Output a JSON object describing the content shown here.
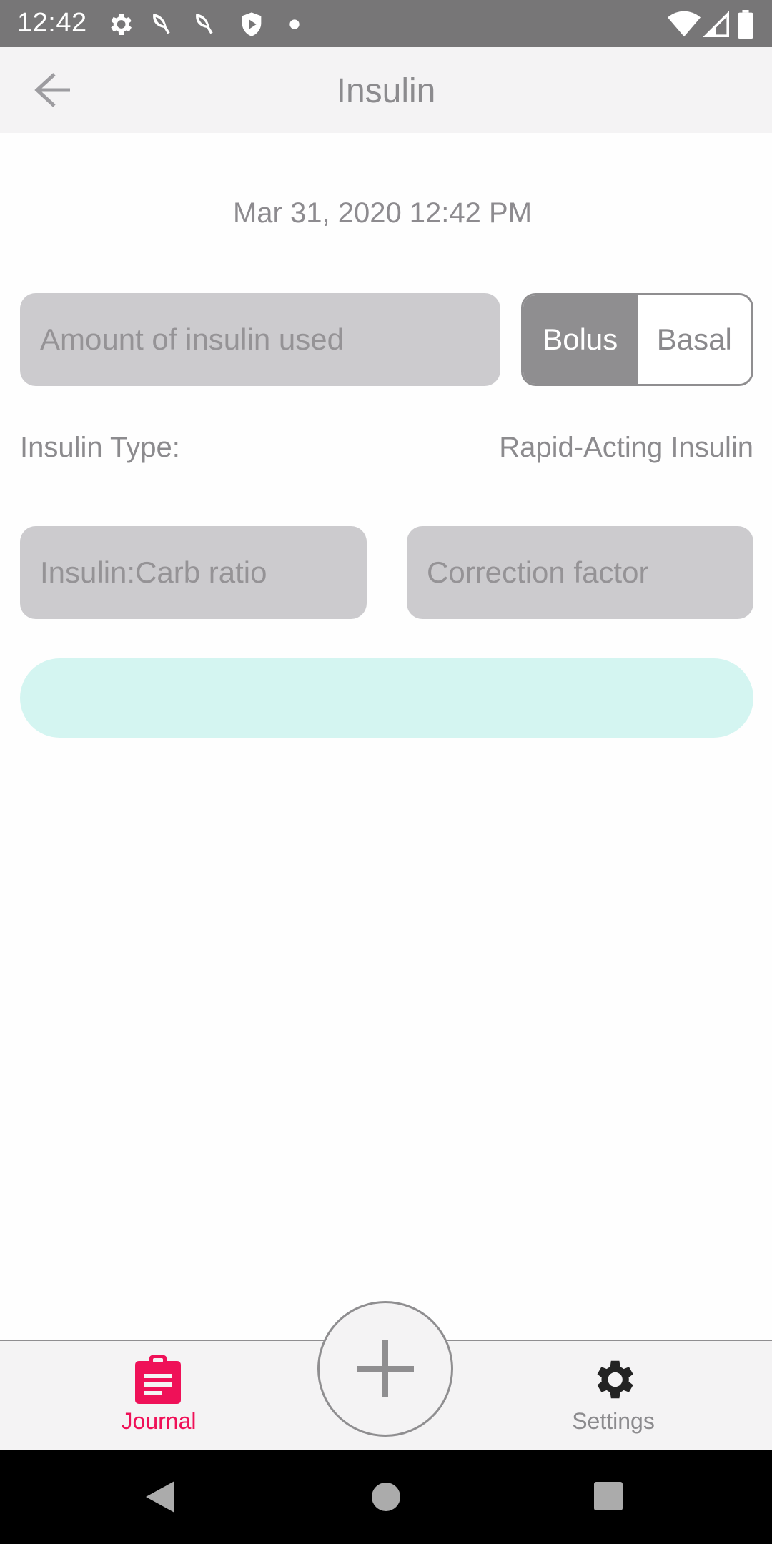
{
  "status_bar": {
    "time": "12:42",
    "left_icons": [
      "gear-icon",
      "leaf-icon",
      "leaf-icon",
      "shield-icon",
      "dot-icon"
    ],
    "right_icons": [
      "wifi-icon",
      "cell-signal-icon",
      "battery-icon"
    ]
  },
  "app_bar": {
    "title": "Insulin",
    "back_icon": "arrow-left-icon"
  },
  "form": {
    "datetime": "Mar 31, 2020 12:42 PM",
    "amount_placeholder": "Amount of insulin used",
    "toggle": {
      "options": [
        "Bolus",
        "Basal"
      ],
      "selected": "Bolus"
    },
    "insulin_type_label": "Insulin Type:",
    "insulin_type_value": "Rapid-Acting Insulin",
    "carb_ratio_placeholder": "Insulin:Carb ratio",
    "correction_factor_placeholder": "Correction factor",
    "save_button_color": "#d4f5f1"
  },
  "bottom_nav": {
    "journal_label": "Journal",
    "settings_label": "Settings",
    "add_icon": "plus-icon",
    "active_color": "#ef1158"
  },
  "system_nav": [
    "back-triangle-icon",
    "home-circle-icon",
    "recents-square-icon"
  ]
}
